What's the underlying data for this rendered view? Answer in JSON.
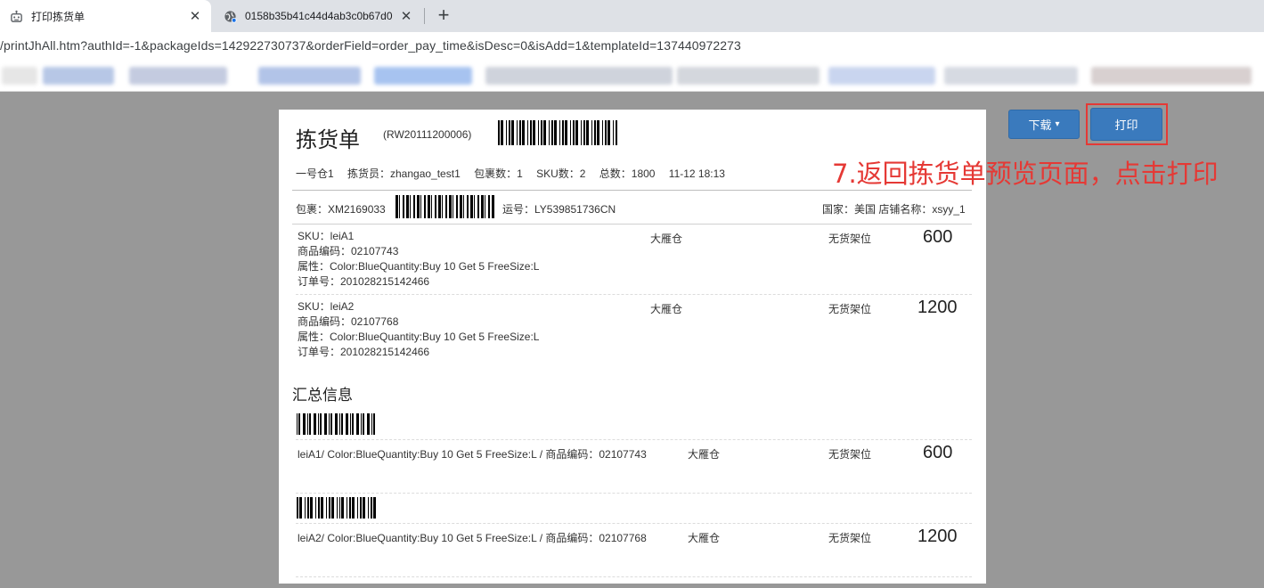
{
  "browser": {
    "tabs": [
      {
        "title": "打印拣货单",
        "icon": "robot-icon",
        "active": true
      },
      {
        "title": "0158b35b41c44d4ab3c0b67d0",
        "icon": "globe-icon",
        "active": false
      }
    ],
    "close_glyph": "✕",
    "new_tab_glyph": "+",
    "url": "/printJhAll.htm?authId=-1&packageIds=142922730737&orderField=order_pay_time&isDesc=0&isAdd=1&templateId=137440972273"
  },
  "sheet": {
    "title": "拣货单",
    "code": "(RW20111200006)",
    "meta": "一号仓1　 拣货员：zhangao_test1　 包裹数：1　 SKU数：2　 总数：1800　 11-12 18:13",
    "package_label": "包裹：XM2169033",
    "tracking_label": "运号：LY539851736CN",
    "country_store": "国家：美国  店铺名称：xsyy_1",
    "items": [
      {
        "sku": "SKU：leiA1",
        "code": "商品编码：02107743",
        "attr": "属性：Color:BlueQuantity:Buy 10 Get 5 FreeSize:L",
        "order": "订单号：201028215142466",
        "warehouse": "大雁仓",
        "shelf": "无货架位",
        "qty": "600"
      },
      {
        "sku": "SKU：leiA2",
        "code": "商品编码：02107768",
        "attr": "属性：Color:BlueQuantity:Buy 10 Get 5 FreeSize:L",
        "order": "订单号：201028215142466",
        "warehouse": "大雁仓",
        "shelf": "无货架位",
        "qty": "1200"
      }
    ],
    "summary_title": "汇总信息",
    "summary": [
      {
        "desc": "leiA1/ Color:BlueQuantity:Buy 10 Get 5 FreeSize:L / 商品编码：02107743",
        "warehouse": "大雁仓",
        "shelf": "无货架位",
        "qty": "600"
      },
      {
        "desc": "leiA2/ Color:BlueQuantity:Buy 10 Get 5 FreeSize:L / 商品编码：02107768",
        "warehouse": "大雁仓",
        "shelf": "无货架位",
        "qty": "1200"
      }
    ]
  },
  "actions": {
    "download_label": "下载",
    "download_caret": "▾",
    "print_label": "打印"
  },
  "annotation": {
    "text": "7.返回拣货单预览页面，点击打印",
    "color": "#e53935"
  },
  "colors": {
    "button": "#3a7abd",
    "page_bg": "#989898"
  }
}
